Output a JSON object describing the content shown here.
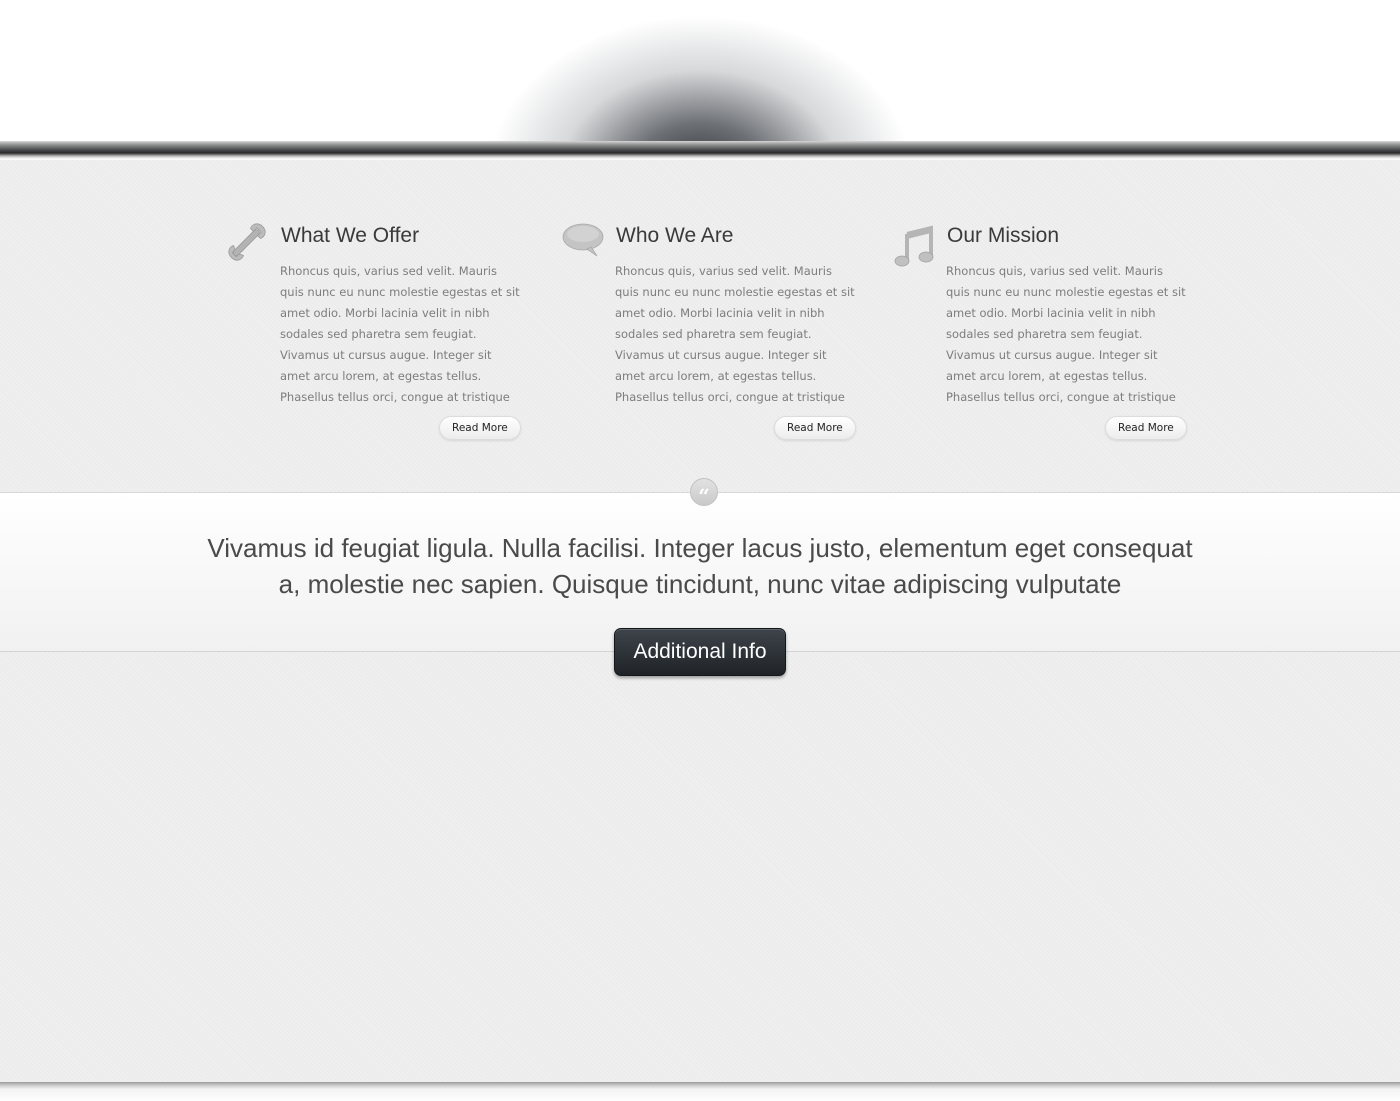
{
  "columns": [
    {
      "icon": "wrench-icon",
      "title": "What We Offer",
      "body": "Rhoncus quis, varius sed velit. Mauris quis nunc eu nunc molestie egestas et sit amet odio. Morbi lacinia velit in nibh sodales sed pharetra sem feugiat. Vivamus ut cursus augue. Integer sit amet arcu lorem, at egestas tellus. Phasellus tellus orci, congue at tristique at, mattis ut arcu. Donec dictum",
      "button": "Read More"
    },
    {
      "icon": "speech-bubble-icon",
      "title": "Who We Are",
      "body": "Rhoncus quis, varius sed velit. Mauris quis nunc eu nunc molestie egestas et sit amet odio. Morbi lacinia velit in nibh sodales sed pharetra sem feugiat. Vivamus ut cursus augue. Integer sit amet arcu lorem, at egestas tellus. Phasellus tellus orci, congue at tristique at, mattis ut arcu. Donec dictum",
      "button": "Read More"
    },
    {
      "icon": "music-note-icon",
      "title": "Our Mission",
      "body": "Rhoncus quis, varius sed velit. Mauris quis nunc eu nunc molestie egestas et sit amet odio. Morbi lacinia velit in nibh sodales sed pharetra sem feugiat. Vivamus ut cursus augue. Integer sit amet arcu lorem, at egestas tellus. Phasellus tellus orci, congue at tristique at, mattis ut arcu. Donec dictum",
      "button": "Read More"
    }
  ],
  "quote": {
    "icon": "quote-mark-icon",
    "mark": "“",
    "text": "Vivamus id feugiat ligula. Nulla facilisi. Integer lacus justo, elementum eget consequat a, molestie nec sapien. Quisque tincidunt, nunc vitae adipiscing vulputate",
    "button": "Additional Info"
  },
  "colors": {
    "header_bar": "#2a2b2d",
    "cta_button": "#2a2f34",
    "body_text": "#7d7d7d",
    "title_text": "#3a3a3a"
  }
}
